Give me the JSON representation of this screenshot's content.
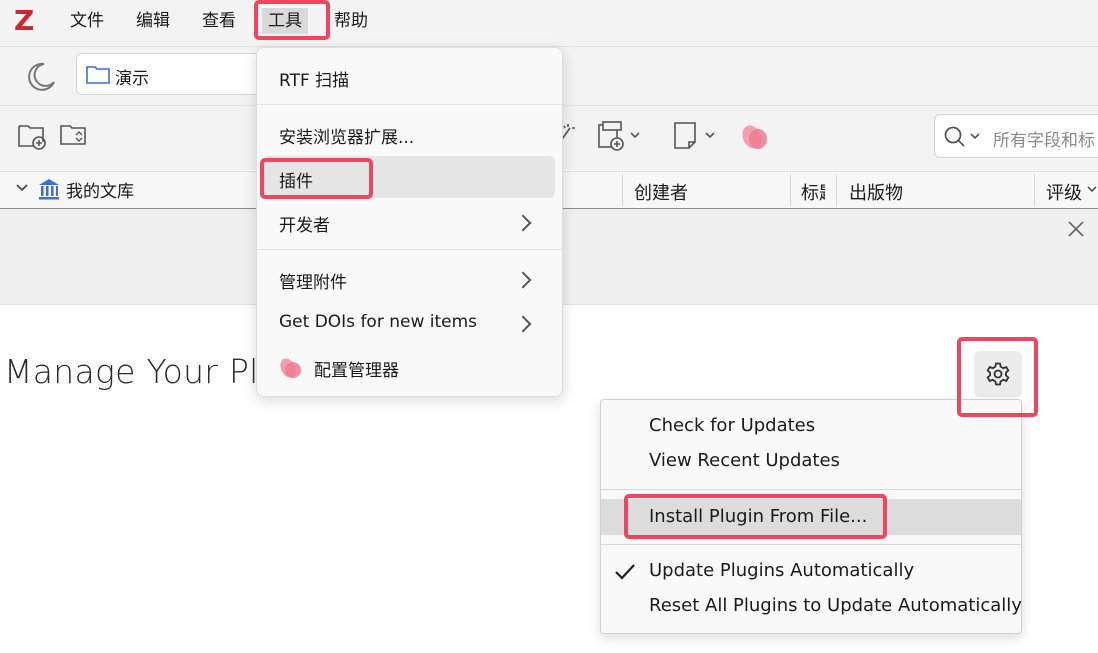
{
  "app": {
    "logo_letter": "Z",
    "accent": "#d02533",
    "highlight_color": "#f0455f"
  },
  "menubar": {
    "items": [
      "文件",
      "编辑",
      "查看",
      "工具",
      "帮助"
    ],
    "active": "工具"
  },
  "toolbar": {
    "collection_name": "演示",
    "search_placeholder": "所有字段和标"
  },
  "library": {
    "tree_root": "我的文库",
    "columns": [
      "创建者",
      "标题",
      "出版物",
      "评级"
    ]
  },
  "tools_menu": {
    "items": [
      {
        "label": "RTF 扫描"
      },
      {
        "label": "安装浏览器扩展..."
      },
      {
        "label": "插件",
        "hovered": true
      },
      {
        "label": "开发者",
        "submenu": true
      },
      {
        "label": "管理附件",
        "submenu": true
      },
      {
        "label": "Get DOIs for new items",
        "submenu": true
      },
      {
        "label": "配置管理器"
      }
    ]
  },
  "plugins_page": {
    "title": "Manage Your Plu"
  },
  "gear_menu": {
    "items": [
      {
        "label": "Check for Updates"
      },
      {
        "label": "View Recent Updates"
      },
      {
        "label": "Install Plugin From File...",
        "hovered": true
      },
      {
        "label": "Update Plugins Automatically",
        "checked": true
      },
      {
        "label": "Reset All Plugins to Update Automatically"
      }
    ]
  },
  "icons": [
    "moon-icon",
    "folder-icon",
    "new-collection-icon",
    "new-subcollection-icon",
    "magic-wand-icon",
    "new-item-icon",
    "new-note-icon",
    "petal-icon",
    "search-icon",
    "library-icon",
    "close-icon",
    "gear-icon",
    "checkmark-icon",
    "chevron-right-icon"
  ]
}
